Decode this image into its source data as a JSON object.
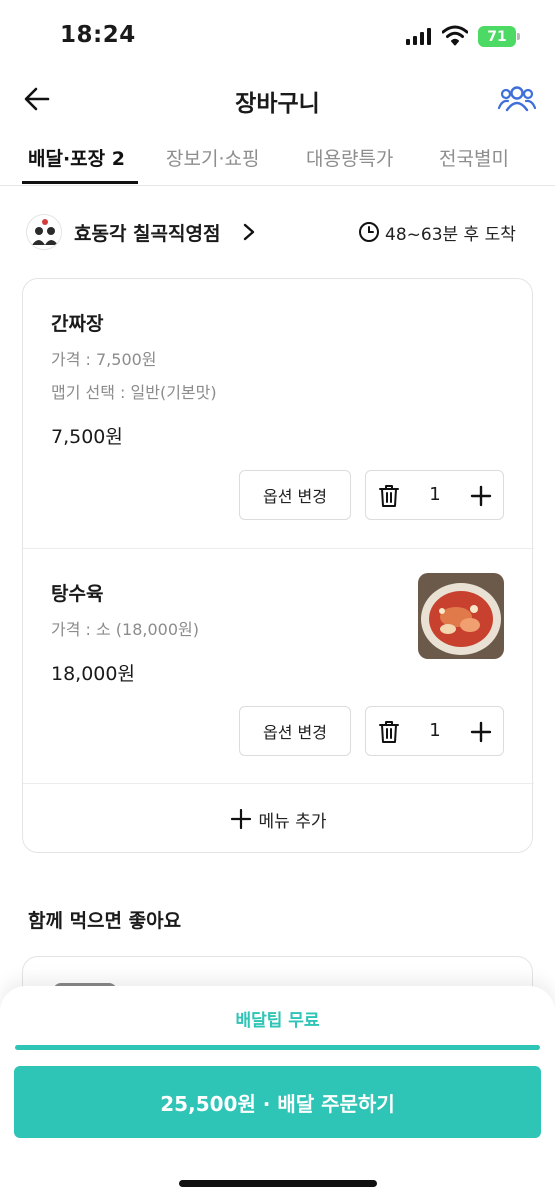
{
  "status_bar": {
    "time": "18:24",
    "battery": "71"
  },
  "header": {
    "title": "장바구니",
    "back_icon": "back-arrow-icon",
    "group_icon": "group-order-icon"
  },
  "tabs": [
    {
      "label": "배달·포장 2",
      "active": true
    },
    {
      "label": "장보기·쇼핑",
      "active": false
    },
    {
      "label": "대용량특가",
      "active": false
    },
    {
      "label": "전국별미",
      "active": false
    }
  ],
  "store": {
    "name": "효동각 칠곡직영점",
    "eta": "48~63분 후 도착"
  },
  "cart": {
    "items": [
      {
        "name": "간짜장",
        "options": [
          "가격 : 7,500원",
          "맵기 선택 : 일반(기본맛)"
        ],
        "price": "7,500원",
        "option_button": "옵션 변경",
        "quantity": "1"
      },
      {
        "name": "탕수육",
        "options": [
          "가격 : 소 (18,000원)"
        ],
        "price": "18,000원",
        "option_button": "옵션 변경",
        "quantity": "1",
        "has_image": true
      }
    ],
    "add_menu_label": "메뉴 추가"
  },
  "recommend": {
    "title": "함께 먹으면 좋아요"
  },
  "bottom_sheet": {
    "delivery_tip": "배달팁 무료",
    "tip_progress": 1.0,
    "order_button": "25,500원 · 배달 주문하기"
  },
  "colors": {
    "accent": "#2ec4b6",
    "group_icon": "#3f6fd8",
    "battery": "#4cd964"
  }
}
